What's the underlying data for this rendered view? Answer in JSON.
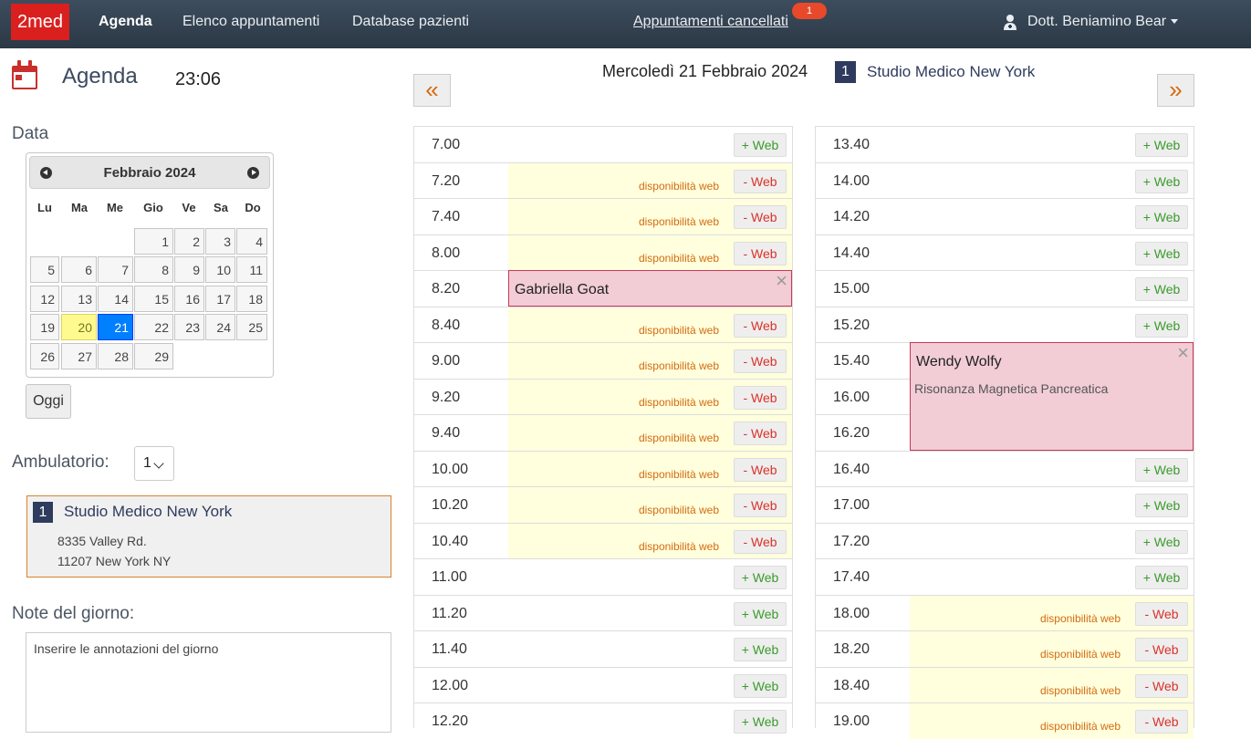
{
  "nav": {
    "brand": "2med",
    "agenda": "Agenda",
    "elenco": "Elenco appuntamenti",
    "database": "Database pazienti",
    "cancellati": "Appuntamenti cancellati",
    "cancellati_badge": "1",
    "user": "Dott. Beniamino Bear"
  },
  "page": {
    "title": "Agenda",
    "clock": "23:06",
    "data_label": "Data",
    "ambulatorio_label": "Ambulatorio:",
    "ambulatorio_value": "1",
    "note_label": "Note del giorno:",
    "note_placeholder": "Inserire le annotazioni del giorno",
    "today_button": "Oggi"
  },
  "calendar": {
    "month": "Febbraio 2024",
    "weekdays": [
      "Lu",
      "Ma",
      "Me",
      "Gio",
      "Ve",
      "Sa",
      "Do"
    ],
    "days": [
      "1",
      "2",
      "3",
      "4",
      "5",
      "6",
      "7",
      "8",
      "9",
      "10",
      "11",
      "12",
      "13",
      "14",
      "15",
      "16",
      "17",
      "18",
      "19",
      "20",
      "21",
      "22",
      "23",
      "24",
      "25",
      "26",
      "27",
      "28",
      "29"
    ],
    "highlighted": "20",
    "selected": "21"
  },
  "studio": {
    "number": "1",
    "name": "Studio Medico New York",
    "address1": "8335 Valley Rd.",
    "address2": "11207 New York NY"
  },
  "day_header": {
    "date": "Mercoledì 21 Febbraio 2024",
    "studio_number": "1",
    "studio_name": "Studio Medico New York",
    "prev": "«",
    "next": "»"
  },
  "labels": {
    "avail": "disponibilità web",
    "add_web": "+ Web",
    "remove_web": "- Web"
  },
  "schedule_left": [
    {
      "time": "7.00",
      "state": "add"
    },
    {
      "time": "7.20",
      "state": "avail"
    },
    {
      "time": "7.40",
      "state": "avail"
    },
    {
      "time": "8.00",
      "state": "avail"
    },
    {
      "time": "8.20",
      "state": "appt"
    },
    {
      "time": "8.40",
      "state": "avail"
    },
    {
      "time": "9.00",
      "state": "avail"
    },
    {
      "time": "9.20",
      "state": "avail"
    },
    {
      "time": "9.40",
      "state": "avail"
    },
    {
      "time": "10.00",
      "state": "avail"
    },
    {
      "time": "10.20",
      "state": "avail"
    },
    {
      "time": "10.40",
      "state": "avail"
    },
    {
      "time": "11.00",
      "state": "add"
    },
    {
      "time": "11.20",
      "state": "add"
    },
    {
      "time": "11.40",
      "state": "add"
    },
    {
      "time": "12.00",
      "state": "add"
    },
    {
      "time": "12.20",
      "state": "add"
    }
  ],
  "schedule_right": [
    {
      "time": "13.40",
      "state": "add"
    },
    {
      "time": "14.00",
      "state": "add"
    },
    {
      "time": "14.20",
      "state": "add"
    },
    {
      "time": "14.40",
      "state": "add"
    },
    {
      "time": "15.00",
      "state": "add"
    },
    {
      "time": "15.20",
      "state": "add"
    },
    {
      "time": "15.40",
      "state": "appt"
    },
    {
      "time": "16.00",
      "state": "appt"
    },
    {
      "time": "16.20",
      "state": "appt"
    },
    {
      "time": "16.40",
      "state": "add"
    },
    {
      "time": "17.00",
      "state": "add"
    },
    {
      "time": "17.20",
      "state": "add"
    },
    {
      "time": "17.40",
      "state": "add"
    },
    {
      "time": "18.00",
      "state": "avail"
    },
    {
      "time": "18.20",
      "state": "avail"
    },
    {
      "time": "18.40",
      "state": "avail"
    },
    {
      "time": "19.00",
      "state": "avail"
    }
  ],
  "appointments": [
    {
      "name": "Gabriella Goat",
      "description": ""
    },
    {
      "name": "Wendy Wolfy",
      "description": "Risonanza Magnetica Pancreatica"
    }
  ],
  "colors": {
    "navbar": "#2f3d4c",
    "brand": "#d9201f",
    "avail_bg": "#ffffdd",
    "appt_bg": "#f2cdd5",
    "accent_orange": "#d36b11",
    "studio_navy": "#2e3b5e"
  }
}
